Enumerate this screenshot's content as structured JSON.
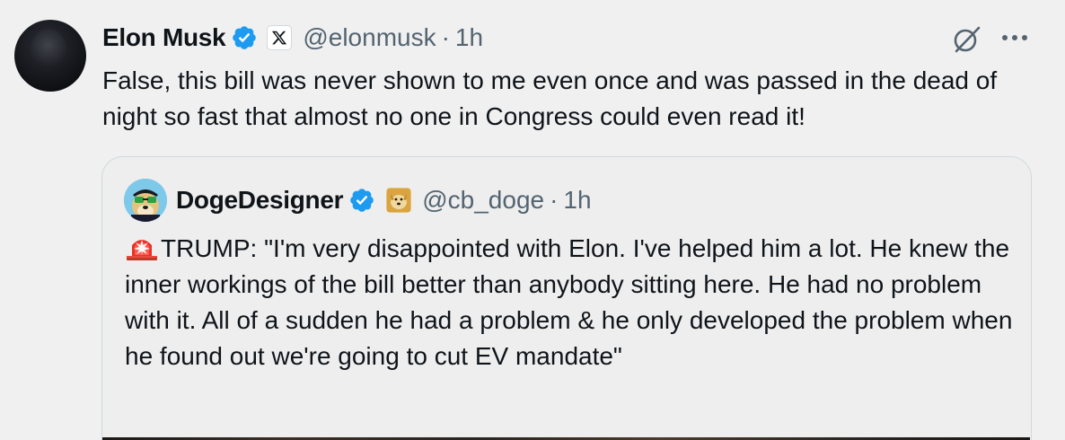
{
  "tweet": {
    "author_name": "Elon Musk",
    "author_handle": "@elonmusk",
    "separator": "·",
    "time": "1h",
    "text": "False, this bill was never shown to me even once and was passed in the dead of night so fast that almost no one in Congress could even read it!",
    "icons": {
      "verified": "verified-badge-icon",
      "affiliate": "x-logo-icon",
      "grok": "grok-icon",
      "more": "more-options-icon"
    }
  },
  "quote": {
    "author_name": "DogeDesigner",
    "author_handle": "@cb_doge",
    "separator": "·",
    "time": "1h",
    "emoji": "rotating-light-icon",
    "text": "TRUMP: \"I'm very disappointed with Elon. I've helped him a lot. He knew the inner workings of the bill better than anybody sitting here. He had no problem with it. All of a sudden he had a problem & he only developed the problem when he found out we're going to cut EV mandate\""
  },
  "colors": {
    "background": "#f0f0f0",
    "text": "#0f1419",
    "secondary_text": "#536471",
    "verified_blue": "#1d9bf0",
    "border": "#cfd9de"
  }
}
